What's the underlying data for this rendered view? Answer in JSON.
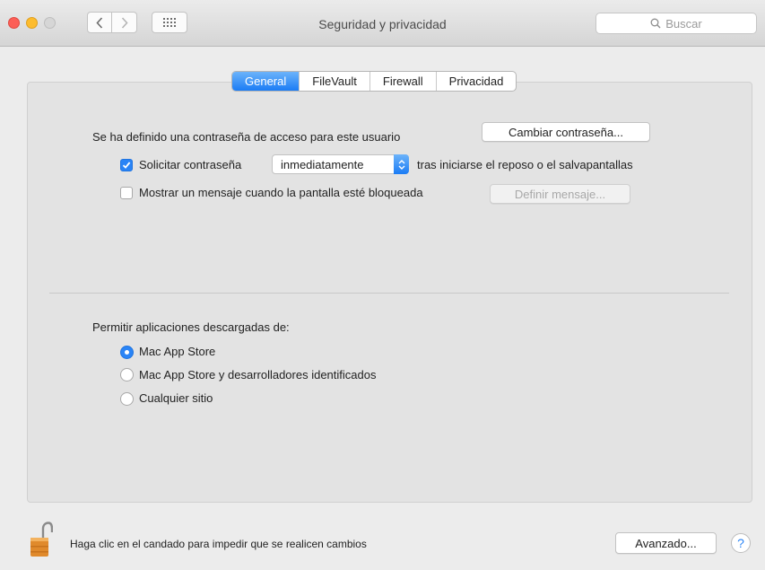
{
  "window": {
    "title": "Seguridad y privacidad",
    "search_placeholder": "Buscar"
  },
  "tabs": [
    {
      "label": "General",
      "active": true
    },
    {
      "label": "FileVault",
      "active": false
    },
    {
      "label": "Firewall",
      "active": false
    },
    {
      "label": "Privacidad",
      "active": false
    }
  ],
  "general": {
    "password_set_text": "Se ha definido una contraseña de acceso para este usuario",
    "change_password_button": "Cambiar contraseña...",
    "require_password": {
      "checked": true,
      "label": "Solicitar contraseña",
      "delay_value": "inmediatamente",
      "suffix": "tras iniciarse el reposo o el salvapantallas"
    },
    "show_message": {
      "checked": false,
      "label": "Mostrar un mensaje cuando la pantalla esté bloqueada",
      "button": "Definir mensaje..."
    },
    "allow_apps_heading": "Permitir aplicaciones descargadas de:",
    "allow_options": [
      {
        "label": "Mac App Store",
        "selected": true
      },
      {
        "label": "Mac App Store y desarrolladores identificados",
        "selected": false
      },
      {
        "label": "Cualquier sitio",
        "selected": false
      }
    ]
  },
  "footer": {
    "lock_text": "Haga clic en el candado para impedir que se realicen cambios",
    "advanced_button": "Avanzado...",
    "help_label": "?"
  },
  "colors": {
    "accent": "#1b7cf5",
    "close": "#fc5f57",
    "minimize": "#fdbc2e"
  }
}
